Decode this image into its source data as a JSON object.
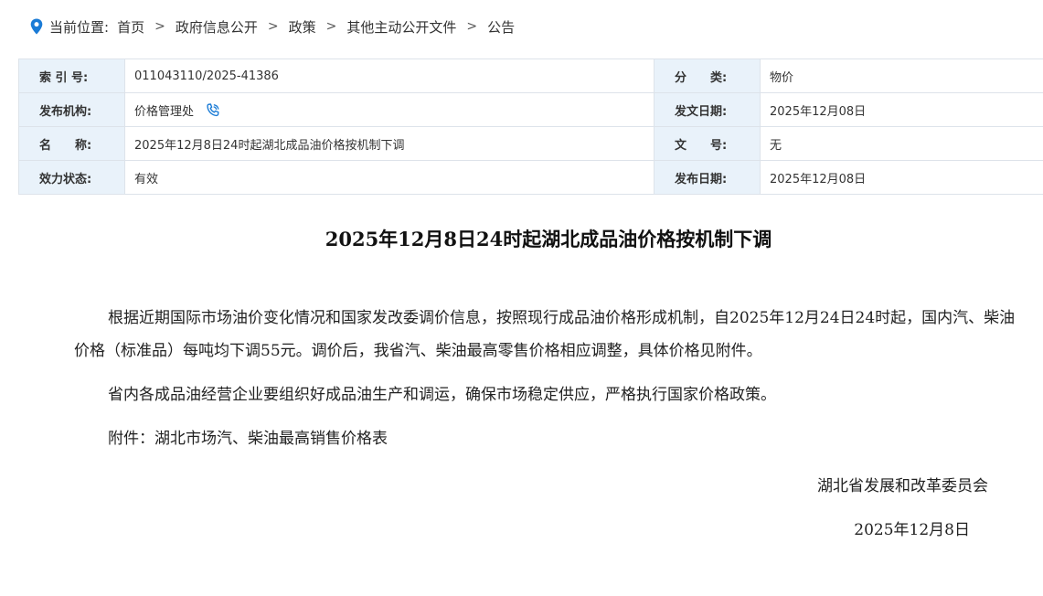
{
  "breadcrumb": {
    "prefix": "当前位置:",
    "items": [
      "首页",
      "政府信息公开",
      "政策",
      "其他主动公开文件",
      "公告"
    ],
    "separator": ">"
  },
  "info": {
    "index_label": "索 引 号:",
    "index_value": "011043110/2025-41386",
    "category_label": "分　　类:",
    "category_value": "物价",
    "publisher_label": "发布机构:",
    "publisher_value": "价格管理处",
    "issue_date_label": "发文日期:",
    "issue_date_value": "2025年12月08日",
    "name_label": "名　　称:",
    "name_value": "2025年12月8日24时起湖北成品油价格按机制下调",
    "doc_no_label": "文　　号:",
    "doc_no_value": "无",
    "status_label": "效力状态:",
    "status_value": "有效",
    "publish_date_label": "发布日期:",
    "publish_date_value": "2025年12月08日"
  },
  "article": {
    "title": "2025年12月8日24时起湖北成品油价格按机制下调",
    "paragraphs": [
      "根据近期国际市场油价变化情况和国家发改委调价信息，按照现行成品油价格形成机制，自2025年12月24日24时起，国内汽、柴油价格（标准品）每吨均下调55元。调价后，我省汽、柴油最高零售价格相应调整，具体价格见附件。",
      "省内各成品油经营企业要组织好成品油生产和调运，确保市场稳定供应，严格执行国家价格政策。"
    ],
    "attachment_prefix": "附件：",
    "attachment_link": "湖北市场汽、柴油最高销售价格表",
    "signature": "湖北省发展和改革委员会",
    "date": "2025年12月8日"
  },
  "colors": {
    "label_bg": "#e9f2fa",
    "border": "#dde3ea",
    "icon_blue": "#1a7bd6"
  },
  "icons": {
    "breadcrumb": "location-pin-icon",
    "publisher": "phone-icon"
  }
}
